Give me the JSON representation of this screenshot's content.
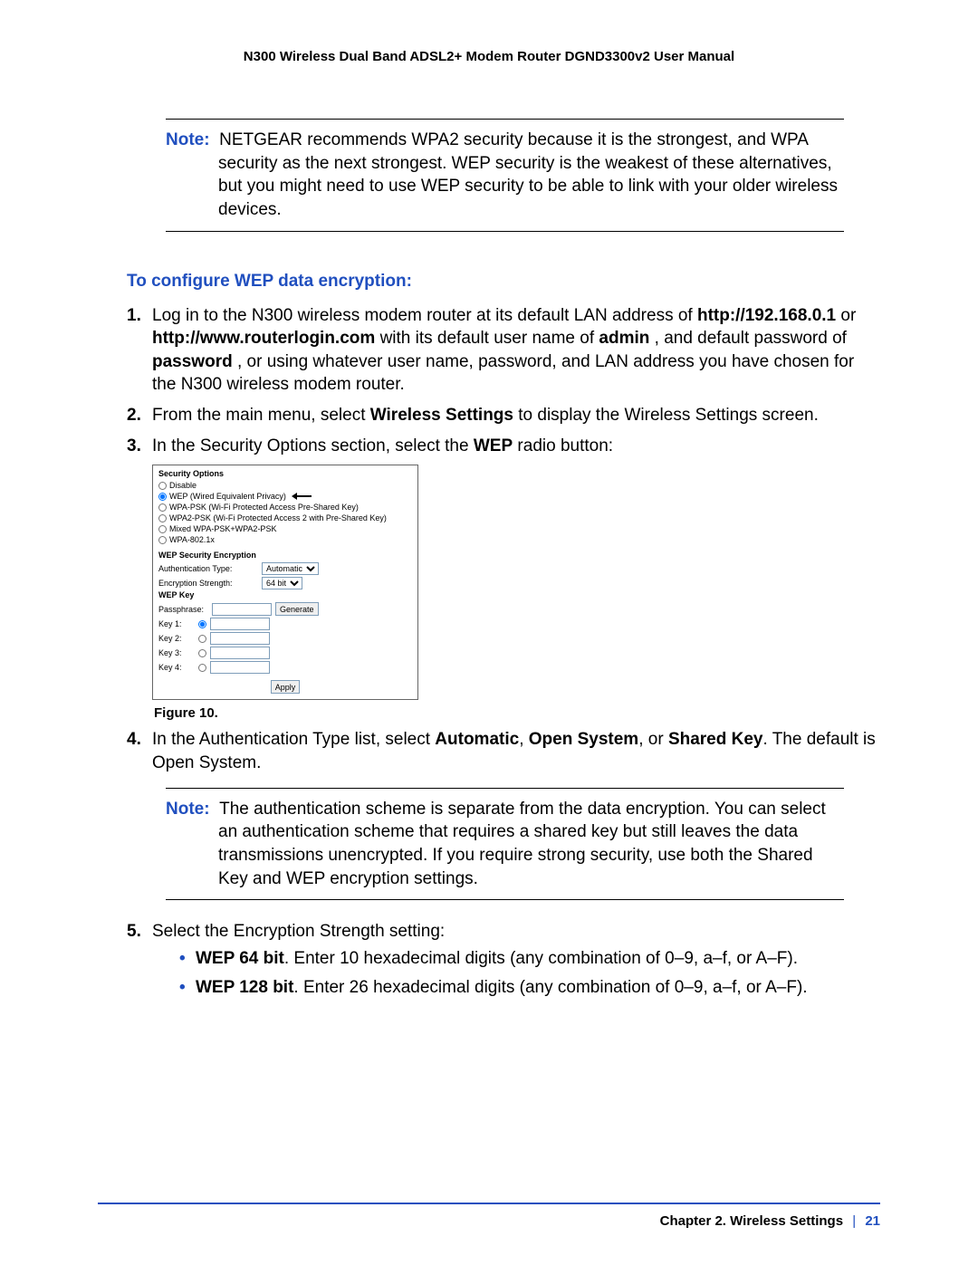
{
  "header": "N300 Wireless Dual Band ADSL2+ Modem Router DGND3300v2 User Manual",
  "note1": {
    "lead": "Note:",
    "text": "NETGEAR recommends WPA2 security because it is the strongest, and WPA security as the next strongest. WEP security is the weakest of these alternatives, but you might need to use WEP security to be able to link with your older wireless devices."
  },
  "section_head": "To configure WEP data encryption:",
  "steps": {
    "s1": {
      "num": "1.",
      "a": "Log in to the N300 wireless modem router at its default LAN address of ",
      "b1": "http://192.168.0.1",
      "mid1": " or ",
      "b2": "http://www.routerlogin.com",
      "mid2": " with its default user name of ",
      "b3": "admin",
      "mid3": ", and default password of ",
      "b4": "password",
      "tail": ", or using whatever user name, password, and LAN address you have chosen for the N300 wireless modem router."
    },
    "s2": {
      "num": "2.",
      "a": "From the main menu, select ",
      "b": "Wireless Settings",
      "c": " to display the Wireless Settings screen."
    },
    "s3": {
      "num": "3.",
      "a": "In the Security Options section, select the ",
      "b": "WEP",
      "c": " radio button:"
    },
    "s4": {
      "num": "4.",
      "a": "In the Authentication Type list, select ",
      "b1": "Automatic",
      "m1": ", ",
      "b2": "Open System",
      "m2": ", or ",
      "b3": "Shared Key",
      "c": ". The default is Open System."
    },
    "s5": {
      "num": "5.",
      "a": "Select the Encryption Strength setting:"
    }
  },
  "figure": {
    "section1": "Security Options",
    "opts": [
      "Disable",
      "WEP (Wired Equivalent Privacy)",
      "WPA-PSK (Wi-Fi Protected Access Pre-Shared Key)",
      "WPA2-PSK (Wi-Fi Protected Access 2 with Pre-Shared Key)",
      "Mixed WPA-PSK+WPA2-PSK",
      "WPA-802.1x"
    ],
    "section2": "WEP Security Encryption",
    "auth_label": "Authentication Type:",
    "auth_value": "Automatic",
    "enc_label": "Encryption Strength:",
    "enc_value": "64 bit",
    "wepkey_label": "WEP Key",
    "pass_label": "Passphrase:",
    "generate": "Generate",
    "key1": "Key 1:",
    "key2": "Key 2:",
    "key3": "Key 3:",
    "key4": "Key 4:",
    "apply": "Apply",
    "caption": "Figure 10."
  },
  "note2": {
    "lead": "Note:",
    "text": "The authentication scheme is separate from the data encryption. You can select an authentication scheme that requires a shared key but still leaves the data transmissions unencrypted. If you require strong security, use both the Shared Key and WEP encryption settings."
  },
  "bullets": {
    "b1a": "WEP 64 bit",
    "b1b": ". Enter 10 hexadecimal digits (any combination of 0–9, a–f, or A–F).",
    "b2a": "WEP 128 bit",
    "b2b": ". Enter 26 hexadecimal digits (any combination of 0–9, a–f, or A–F)."
  },
  "footer": {
    "chapter": "Chapter 2.  Wireless Settings",
    "sep": "|",
    "page": "21"
  }
}
